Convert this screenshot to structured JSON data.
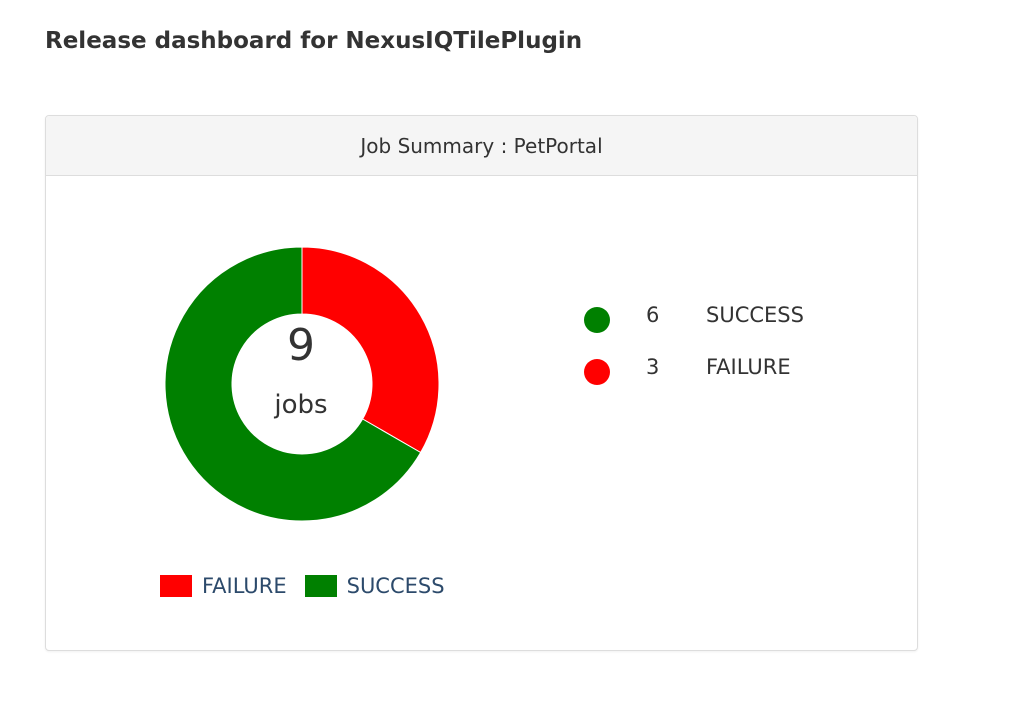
{
  "page": {
    "title": "Release dashboard for NexusIQTilePlugin"
  },
  "panel": {
    "header": "Job Summary : PetPortal",
    "center": {
      "count": "9",
      "unit": "jobs"
    },
    "status_list": [
      {
        "count": "6",
        "label": "SUCCESS",
        "color": "#008000"
      },
      {
        "count": "3",
        "label": "FAILURE",
        "color": "#ff0000"
      }
    ],
    "legend": [
      {
        "label": "FAILURE",
        "color": "#ff0000"
      },
      {
        "label": "SUCCESS",
        "color": "#008000"
      }
    ]
  },
  "chart_data": {
    "type": "pie",
    "categories": [
      "FAILURE",
      "SUCCESS"
    ],
    "values": [
      3,
      6
    ],
    "colors": [
      "#ff0000",
      "#008000"
    ],
    "donut": true,
    "legend_position": "bottom-left"
  }
}
